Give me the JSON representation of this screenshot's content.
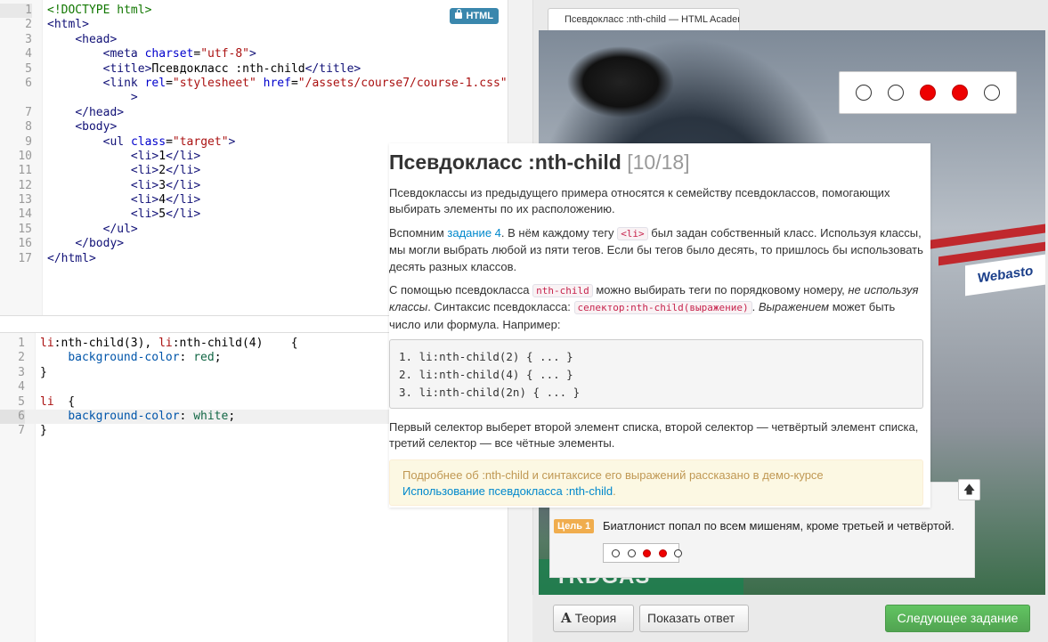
{
  "html_editor": {
    "badge": "HTML",
    "line_numbers": [
      "1",
      "2",
      "3",
      "4",
      "5",
      "6",
      "",
      "7",
      "8",
      "9",
      "10",
      "11",
      "12",
      "13",
      "14",
      "15",
      "16",
      "17"
    ],
    "lines": [
      [
        {
          "c": "t",
          "v": "<!DOCTYPE html>"
        }
      ],
      [
        {
          "c": "tag",
          "v": "<html>"
        }
      ],
      [
        {
          "c": "",
          "v": "    "
        },
        {
          "c": "tag",
          "v": "<head>"
        }
      ],
      [
        {
          "c": "",
          "v": "        "
        },
        {
          "c": "tag",
          "v": "<meta "
        },
        {
          "c": "attr",
          "v": "charset"
        },
        {
          "c": "",
          "v": "="
        },
        {
          "c": "str",
          "v": "\"utf-8\""
        },
        {
          "c": "tag",
          "v": ">"
        }
      ],
      [
        {
          "c": "",
          "v": "        "
        },
        {
          "c": "tag",
          "v": "<title>"
        },
        {
          "c": "",
          "v": "Псевдокласс :nth-child"
        },
        {
          "c": "tag",
          "v": "</title>"
        }
      ],
      [
        {
          "c": "",
          "v": "        "
        },
        {
          "c": "tag",
          "v": "<link "
        },
        {
          "c": "attr",
          "v": "rel"
        },
        {
          "c": "",
          "v": "="
        },
        {
          "c": "str",
          "v": "\"stylesheet\""
        },
        {
          "c": "",
          "v": " "
        },
        {
          "c": "attr",
          "v": "href"
        },
        {
          "c": "",
          "v": "="
        },
        {
          "c": "str",
          "v": "\"/assets/course7/course-1.css\""
        }
      ],
      [
        {
          "c": "",
          "v": "            "
        },
        {
          "c": "tag",
          "v": ">"
        }
      ],
      [
        {
          "c": "",
          "v": "    "
        },
        {
          "c": "tag",
          "v": "</head>"
        }
      ],
      [
        {
          "c": "",
          "v": "    "
        },
        {
          "c": "tag",
          "v": "<body>"
        }
      ],
      [
        {
          "c": "",
          "v": "        "
        },
        {
          "c": "tag",
          "v": "<ul "
        },
        {
          "c": "attr",
          "v": "class"
        },
        {
          "c": "",
          "v": "="
        },
        {
          "c": "str",
          "v": "\"target\""
        },
        {
          "c": "tag",
          "v": ">"
        }
      ],
      [
        {
          "c": "",
          "v": "            "
        },
        {
          "c": "tag",
          "v": "<li>"
        },
        {
          "c": "",
          "v": "1"
        },
        {
          "c": "tag",
          "v": "</li>"
        }
      ],
      [
        {
          "c": "",
          "v": "            "
        },
        {
          "c": "tag",
          "v": "<li>"
        },
        {
          "c": "",
          "v": "2"
        },
        {
          "c": "tag",
          "v": "</li>"
        }
      ],
      [
        {
          "c": "",
          "v": "            "
        },
        {
          "c": "tag",
          "v": "<li>"
        },
        {
          "c": "",
          "v": "3"
        },
        {
          "c": "tag",
          "v": "</li>"
        }
      ],
      [
        {
          "c": "",
          "v": "            "
        },
        {
          "c": "tag",
          "v": "<li>"
        },
        {
          "c": "",
          "v": "4"
        },
        {
          "c": "tag",
          "v": "</li>"
        }
      ],
      [
        {
          "c": "",
          "v": "            "
        },
        {
          "c": "tag",
          "v": "<li>"
        },
        {
          "c": "",
          "v": "5"
        },
        {
          "c": "tag",
          "v": "</li>"
        }
      ],
      [
        {
          "c": "",
          "v": "        "
        },
        {
          "c": "tag",
          "v": "</ul>"
        }
      ],
      [
        {
          "c": "",
          "v": "    "
        },
        {
          "c": "tag",
          "v": "</body>"
        }
      ],
      [
        {
          "c": "tag",
          "v": "</html>"
        }
      ]
    ]
  },
  "css_editor": {
    "line_numbers": [
      "1",
      "2",
      "3",
      "4",
      "5",
      "6",
      "7"
    ],
    "lines": [
      [
        {
          "c": "sel",
          "v": "li"
        },
        {
          "c": "",
          "v": ":nth-child(3), "
        },
        {
          "c": "sel",
          "v": "li"
        },
        {
          "c": "",
          "v": ":nth-child(4)    {"
        }
      ],
      [
        {
          "c": "",
          "v": "    "
        },
        {
          "c": "prop",
          "v": "background-color"
        },
        {
          "c": "",
          "v": ": "
        },
        {
          "c": "val",
          "v": "red"
        },
        {
          "c": "",
          "v": ";"
        }
      ],
      [
        {
          "c": "",
          "v": "}"
        }
      ],
      [
        {
          "c": "",
          "v": ""
        }
      ],
      [
        {
          "c": "sel",
          "v": "li"
        },
        {
          "c": "",
          "v": "  {"
        }
      ],
      [
        {
          "c": "",
          "v": "    "
        },
        {
          "c": "prop",
          "v": "background-color"
        },
        {
          "c": "",
          "v": ": "
        },
        {
          "c": "val",
          "v": "white"
        },
        {
          "c": "",
          "v": ";"
        }
      ],
      [
        {
          "c": "",
          "v": "}"
        }
      ]
    ]
  },
  "preview": {
    "tab_title": "Псевдокласс :nth-child — HTML Academy",
    "targets": [
      "white",
      "white",
      "red",
      "red",
      "white"
    ],
    "sign_text": "Webasto",
    "banner_text": "TRDGAS",
    "goal_badge": "Цель 1",
    "goal_text": "Биатлонист попал по всем мишеням, кроме третьей и четвёртой.",
    "goal_targets": [
      "white",
      "white",
      "red",
      "red",
      "white"
    ],
    "up_icon": "arrow-up-icon"
  },
  "bottom_bar": {
    "theory_icon": "A",
    "theory_label": "Теория",
    "answer_label": "Показать ответ",
    "next_label": "Следующее задание"
  },
  "popup": {
    "title": "Псевдокласс :nth-child",
    "counter": "[10/18]",
    "p1": "Псевдоклассы из предыдущего примера относятся к семейству псевдоклассов, помогающих выбирать элементы по их расположению.",
    "p2_a": "Вспомним ",
    "p2_link": "задание 4",
    "p2_b": ". В нём каждому тегу ",
    "p2_code": "<li>",
    "p2_c": " был задан собственный класс. Используя классы, мы могли выбрать любой из пяти тегов. Если бы тегов было десять, то пришлось бы использовать десять разных классов.",
    "p3_a": "С помощью псевдокласса ",
    "p3_code1": "nth-child",
    "p3_b": " можно выбирать теги по порядковому номеру, ",
    "p3_em1": "не используя классы",
    "p3_c": ". Синтаксис псевдокласса: ",
    "p3_code2": "селектор:nth-child(выражение)",
    "p3_d": ". ",
    "p3_em2": "Выражением",
    "p3_e": " может быть число или формула. Например:",
    "code_lines": [
      "1. li:nth-child(2) { ... }",
      "2. li:nth-child(4) { ... }",
      "3. li:nth-child(2n) { ... }"
    ],
    "p4": "Первый селектор выберет второй элемент списка, второй селектор — четвёртый элемент списка, третий селектор — все чётные элементы.",
    "note_text": "Подробнее об :nth-child и синтаксисе его выражений рассказано в демо-курсе ",
    "note_link": "Использование псевдокласса :nth-child",
    "note_end": "."
  }
}
